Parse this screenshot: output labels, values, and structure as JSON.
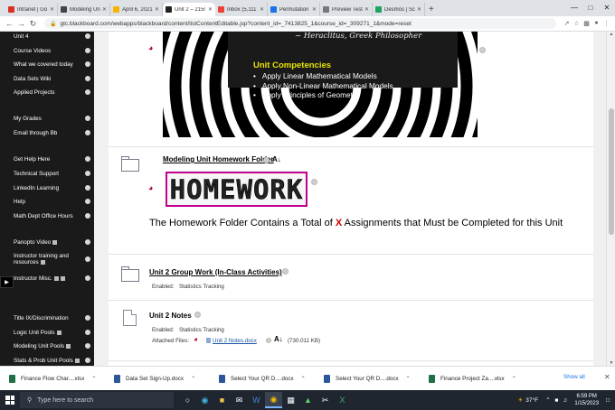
{
  "browser": {
    "tabs": [
      {
        "label": "Intranet | Go",
        "color": "#d93025"
      },
      {
        "label": "Modeling Un",
        "color": "#444444"
      },
      {
        "label": "April 6, 2021",
        "color": "#f4b400"
      },
      {
        "label": "Unit 2 – 215l",
        "color": "#222222"
      },
      {
        "label": "Inbox (5,111",
        "color": "#ea4335"
      },
      {
        "label": "Permutation",
        "color": "#1a73e8"
      },
      {
        "label": "Preview Test",
        "color": "#777777"
      },
      {
        "label": "Desmos | Sc",
        "color": "#1ea362"
      }
    ],
    "active_tab_index": 3,
    "url": "gtc.blackboard.com/webapps/blackboard/content/listContentEditable.jsp?content_id=_7413825_1&course_id=_309271_1&mode=reset"
  },
  "sidebar": {
    "items": [
      "Unit 4",
      "Course Videos",
      "What we covered today",
      "Data Sets Wiki",
      "Applied Projects",
      "My Grades",
      "Email through Bb",
      "Get Help Here",
      "Technical Support",
      "LinkedIn Learning",
      "Help",
      "Math Dept Office Hours",
      "Panopto Video",
      "Instructor training and resources",
      "Instructor Misc.",
      "Title IX/Discrimination",
      "Logic Unit Pools",
      "Modeling Unit Pools",
      "Stats & Prob Unit Pools"
    ]
  },
  "banner": {
    "quote": "~ Heraclitus, Greek Philosopher",
    "title": "Unit Competencies",
    "items": [
      "Apply Linear Mathematical Models",
      "Apply Non-Linear Mathematical Models",
      "Apply Principles of Geometry"
    ]
  },
  "homework_folder": {
    "title": "Modeling Unit Homework Folder",
    "image_text": "HOMEWORK",
    "statement_pre": "The Homework Folder Contains a Total of ",
    "statement_x": "X",
    "statement_post": " Assignments that Must be Completed for this Unit"
  },
  "group_work": {
    "title": "Unit 2 Group Work (In-Class Activities)",
    "enabled_label": "Enabled:",
    "enabled_value": "Statistics Tracking"
  },
  "notes": {
    "title": "Unit 2 Notes",
    "enabled_label": "Enabled:",
    "enabled_value": "Statistics Tracking",
    "attached_label": "Attached Files:",
    "file_name": "Unit 2 Notes.docx",
    "file_size": "(730.011 KB)"
  },
  "downloads": {
    "items": [
      {
        "name": "Finance Flow Char....xlsx",
        "color": "#1e7145"
      },
      {
        "name": "Data Set Sign-Up.docx",
        "color": "#2b579a"
      },
      {
        "name": "Select Your QR D....docx",
        "color": "#2b579a"
      },
      {
        "name": "Select Your QR D....docx",
        "color": "#2b579a"
      },
      {
        "name": "Finance Project Za....xlsx",
        "color": "#1e7145"
      }
    ],
    "show_all": "Show all"
  },
  "taskbar": {
    "search_placeholder": "Type here to search",
    "weather": "37°F",
    "time": "6:59 PM",
    "date": "1/15/2023"
  }
}
